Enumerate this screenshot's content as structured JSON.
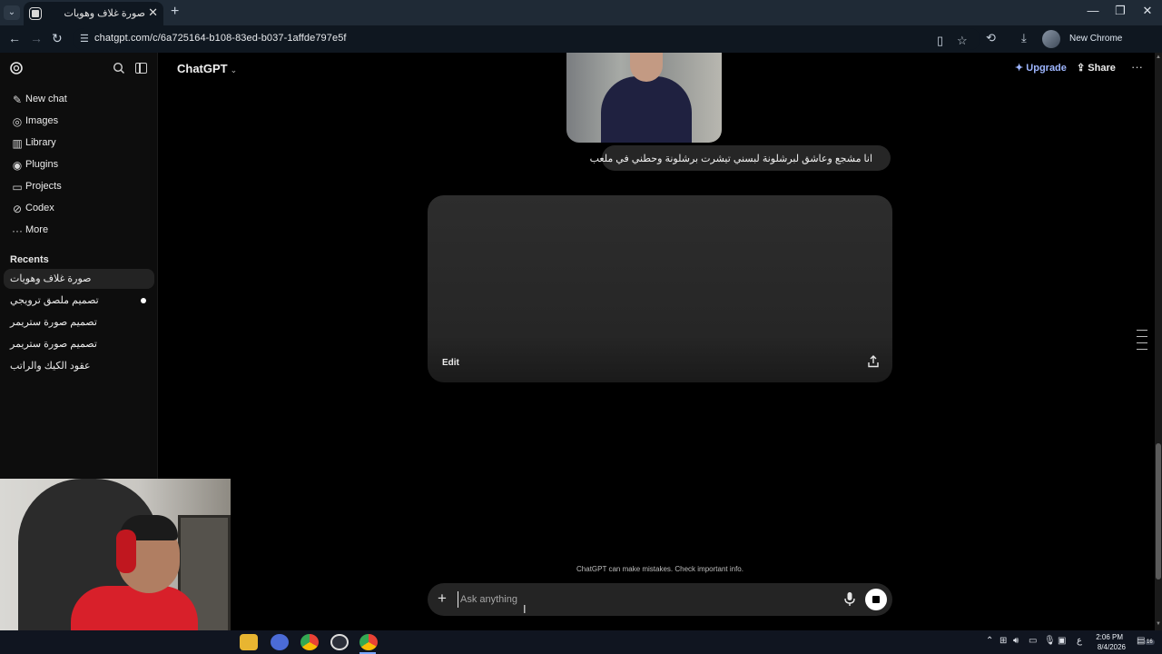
{
  "browser": {
    "tab_title": "صورة غلاف وهويات",
    "tab_close": "✕",
    "new_tab": "+",
    "url": "chatgpt.com/c/6a725164-b108-83ed-b037-1affde797e5f",
    "new_chrome_label": "New Chrome available",
    "window_controls": {
      "minimize": "—",
      "restore": "❐",
      "close": "✕"
    }
  },
  "sidebar": {
    "items": [
      {
        "label": "New chat",
        "icon": "edit-icon"
      },
      {
        "label": "Images",
        "icon": "images-icon"
      },
      {
        "label": "Library",
        "icon": "library-icon"
      },
      {
        "label": "Plugins",
        "icon": "plugins-icon"
      },
      {
        "label": "Projects",
        "icon": "projects-icon"
      },
      {
        "label": "Codex",
        "icon": "codex-icon"
      },
      {
        "label": "More",
        "icon": "more-icon"
      }
    ],
    "recents_header": "Recents",
    "recents": [
      "صورة غلاف وهويات",
      "تصميم ملصق ترويجي",
      "تصميم صورة ستريمر",
      "تصميم صورة ستريمر",
      "عقود الكيك والراتب"
    ]
  },
  "header": {
    "model": "ChatGPT",
    "upgrade": "Upgrade",
    "share": "Share"
  },
  "conversation": {
    "user_message": "انا مشجع وعاشق لبرشلونة لبسني تيشرت برشلونة وحطني في ملعب",
    "edit_label": "Edit"
  },
  "composer": {
    "placeholder": "Ask anything",
    "disclaimer": "ChatGPT can make mistakes. Check important info."
  },
  "taskbar": {
    "time": "2:06 PM",
    "date": "8/4/2026",
    "lang": "ع",
    "notifications": "16"
  },
  "colors": {
    "accent": "#9eb6ff",
    "bubble": "#262626",
    "composer": "#242424"
  }
}
